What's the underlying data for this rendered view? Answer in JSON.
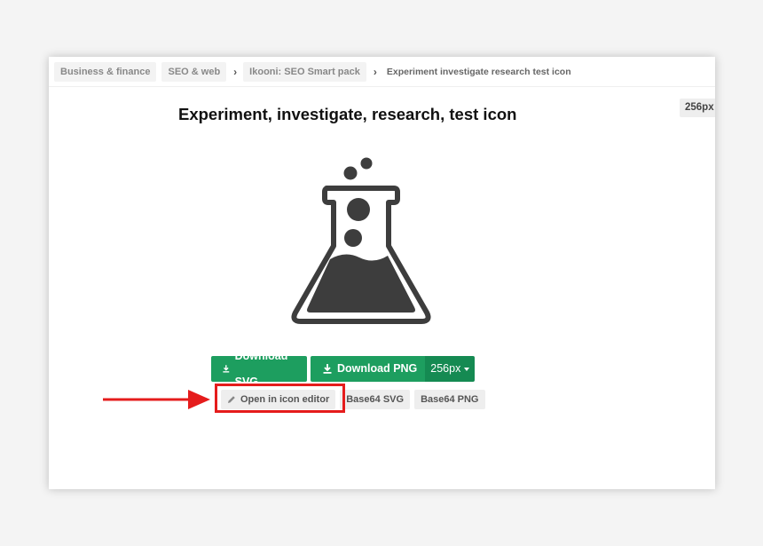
{
  "breadcrumb": {
    "items": [
      "Business & finance",
      "SEO & web",
      "Ikooni: SEO Smart pack"
    ],
    "current": "Experiment investigate research test icon"
  },
  "page": {
    "title": "Experiment, investigate, research, test icon",
    "size_tag": "256px"
  },
  "icon": {
    "name": "flask-icon",
    "color": "#3d3d3d"
  },
  "downloads": {
    "svg_label": "Download SVG",
    "png_label": "Download PNG",
    "png_size": "256px",
    "color": "#1d9e5f"
  },
  "secondary": {
    "editor_label": "Open in icon editor",
    "base64_svg_label": "Base64 SVG",
    "base64_png_label": "Base64 PNG"
  },
  "annotation": {
    "color": "#e51c1c"
  }
}
